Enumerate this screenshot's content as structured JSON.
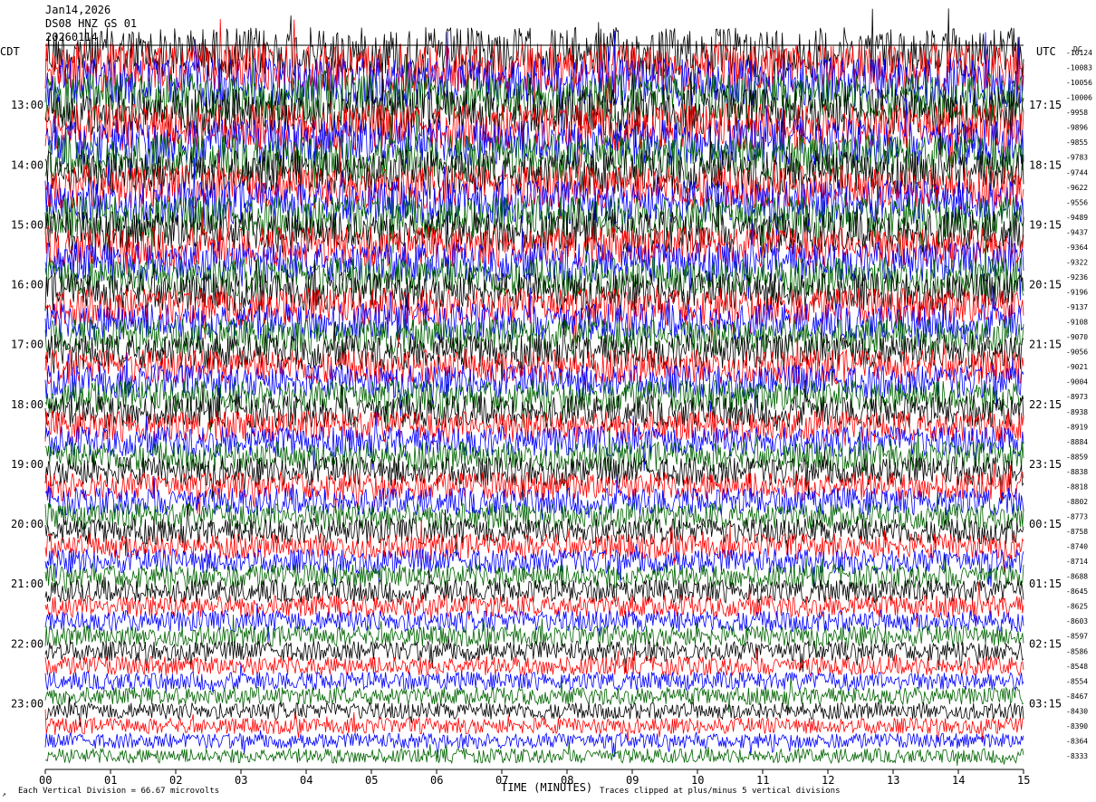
{
  "header": {
    "date": "Jan14,2026",
    "channel": "DS08 HNZ GS 01",
    "extra": "20260114"
  },
  "chart_data": {
    "type": "helicorder",
    "title": "",
    "xlabel": "TIME (MINUTES)",
    "x_ticks": [
      "00",
      "01",
      "02",
      "03",
      "04",
      "05",
      "06",
      "07",
      "08",
      "09",
      "10",
      "11",
      "12",
      "13",
      "14",
      "15"
    ],
    "xlim": [
      0,
      15
    ],
    "left_timezone": "CDT",
    "right_timezone": "UTC",
    "left_hour_labels": [
      "13:00",
      "14:00",
      "15:00",
      "16:00",
      "17:00",
      "18:00",
      "19:00",
      "20:00",
      "21:00",
      "22:00",
      "23:00"
    ],
    "right_hour_labels": [
      "17:15",
      "18:15",
      "19:15",
      "20:15",
      "21:15",
      "22:15",
      "23:15",
      "00:15",
      "01:15",
      "02:15",
      "03:15"
    ],
    "right_unit": "DC",
    "right_offsets": [
      "-10124",
      "-10083",
      "-10056",
      "-10006",
      "-9958",
      "-9896",
      "-9855",
      "-9783",
      "-9744",
      "-9622",
      "-9556",
      "-9489",
      "-9437",
      "-9364",
      "-9322",
      "-9236",
      "-9196",
      "-9137",
      "-9108",
      "-9070",
      "-9056",
      "-9021",
      "-9004",
      "-8973",
      "-8938",
      "-8919",
      "-8884",
      "-8859",
      "-8838",
      "-8818",
      "-8802",
      "-8773",
      "-8758",
      "-8740",
      "-8714",
      "-8688",
      "-8645",
      "-8625",
      "-8603",
      "-8597",
      "-8586",
      "-8548",
      "-8554",
      "-8467",
      "-8430",
      "-8390",
      "-8364",
      "-8333"
    ],
    "trace_count": 48,
    "trace_colors": [
      "#000000",
      "#ff0000",
      "#0000ff",
      "#006400"
    ],
    "footer_left": "Each Vertical Division =   66.67 microvolts",
    "footer_right": "Traces clipped at plus/minus 5 vertical divisions",
    "corner_mark": "↗"
  }
}
